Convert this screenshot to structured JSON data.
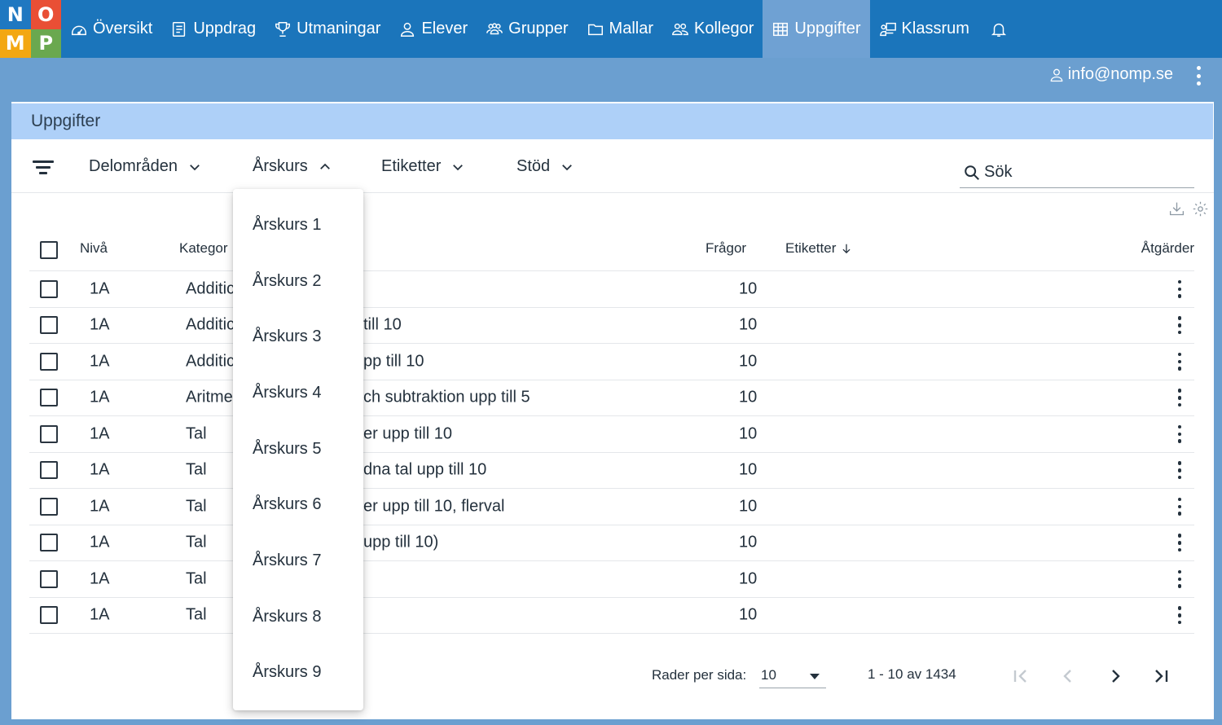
{
  "logo": {
    "letters": [
      "N",
      "O",
      "M",
      "P"
    ]
  },
  "nav": {
    "items": [
      {
        "label": "Översikt"
      },
      {
        "label": "Uppdrag"
      },
      {
        "label": "Utmaningar"
      },
      {
        "label": "Elever"
      },
      {
        "label": "Grupper"
      },
      {
        "label": "Mallar"
      },
      {
        "label": "Kollegor"
      },
      {
        "label": "Uppgifter",
        "active": true
      },
      {
        "label": "Klassrum"
      }
    ]
  },
  "user": {
    "email": "info@nomp.se"
  },
  "page": {
    "title": "Uppgifter"
  },
  "filters": {
    "delomraden": "Delområden",
    "arskurs": "Årskurs",
    "etiketter": "Etiketter",
    "stod": "Stöd",
    "search_placeholder": "Sök"
  },
  "table": {
    "headers": {
      "niva": "Nivå",
      "kategori": "Kategor",
      "fragor": "Frågor",
      "etiketter": "Etiketter",
      "atgarder": "Åtgärder"
    },
    "rows": [
      {
        "niva": "1A",
        "kategori": "Additic",
        "name": "",
        "fragor": "10"
      },
      {
        "niva": "1A",
        "kategori": "Additic",
        "name": "till 10",
        "fragor": "10"
      },
      {
        "niva": "1A",
        "kategori": "Additic",
        "name": "pp till 10",
        "fragor": "10"
      },
      {
        "niva": "1A",
        "kategori": "Aritme",
        "name": "ch subtraktion upp till 5",
        "fragor": "10"
      },
      {
        "niva": "1A",
        "kategori": "Tal",
        "name": "er upp till 10",
        "fragor": "10"
      },
      {
        "niva": "1A",
        "kategori": "Tal",
        "name": "dna tal upp till 10",
        "fragor": "10"
      },
      {
        "niva": "1A",
        "kategori": "Tal",
        "name": "er upp till 10, flerval",
        "fragor": "10"
      },
      {
        "niva": "1A",
        "kategori": "Tal",
        "name": "upp till 10)",
        "fragor": "10"
      },
      {
        "niva": "1A",
        "kategori": "Tal",
        "name": "",
        "fragor": "10"
      },
      {
        "niva": "1A",
        "kategori": "Tal",
        "name": "",
        "fragor": "10"
      }
    ]
  },
  "pagination": {
    "rows_per_page_label": "Rader per sida:",
    "rows_per_page": "10",
    "range": "1 - 10 av 1434"
  },
  "dropdown": {
    "items": [
      "Årskurs 1",
      "Årskurs 2",
      "Årskurs 3",
      "Årskurs 4",
      "Årskurs 5",
      "Årskurs 6",
      "Årskurs 7",
      "Årskurs 8",
      "Årskurs 9"
    ]
  }
}
